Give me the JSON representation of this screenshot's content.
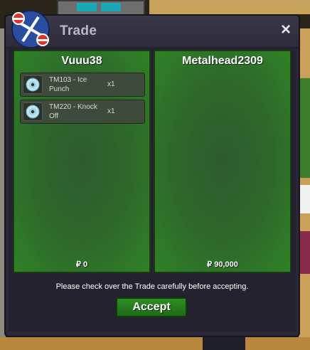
{
  "window": {
    "title": "Trade",
    "close_label": "×"
  },
  "left_panel": {
    "player": "Vuuu38",
    "money": "₽ 0",
    "items": [
      {
        "name": "TM103 - Ice Punch",
        "qty": "x1",
        "icon": "disc-icon"
      },
      {
        "name": "TM220 - Knock Off",
        "qty": "x1",
        "icon": "disc-icon"
      }
    ]
  },
  "right_panel": {
    "player": "Metalhead2309",
    "money": "₽ 90,000",
    "items": []
  },
  "notice": "Please check over the Trade carefully before accepting.",
  "accept_label": "Accept",
  "colors": {
    "panel_green": "#2d6a2a",
    "button_green": "#2f8e24",
    "window_bg": "#2a2836"
  }
}
